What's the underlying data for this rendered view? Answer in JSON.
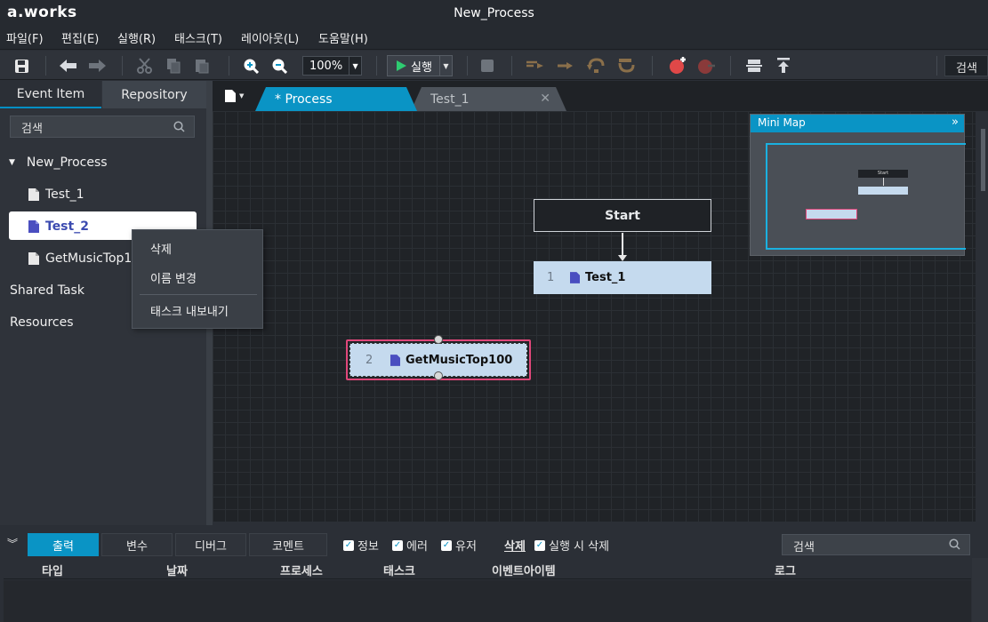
{
  "app": {
    "logo": "a.works",
    "window_title": "New_Process"
  },
  "menu": [
    "파일(F)",
    "편집(E)",
    "실행(R)",
    "태스크(T)",
    "레이아웃(L)",
    "도움말(H)"
  ],
  "toolbar": {
    "zoom": "100%",
    "run_label": "실행",
    "search_label": "검색"
  },
  "left_panel": {
    "tabs": [
      "Event Item",
      "Repository"
    ],
    "active_tab": "Repository",
    "search_placeholder": "검색",
    "tree": {
      "root": "New_Process",
      "children": [
        "Test_1",
        "Test_2",
        "GetMusicTop10"
      ],
      "selected": "Test_2"
    },
    "sections": [
      "Shared Task",
      "Resources"
    ]
  },
  "context_menu": {
    "items": [
      "삭제",
      "이름 변경",
      "태스크 내보내기"
    ]
  },
  "doc_tabs": [
    {
      "label": "* Process",
      "active": true
    },
    {
      "label": "Test_1",
      "active": false
    }
  ],
  "canvas": {
    "start_label": "Start",
    "nodes": [
      {
        "num": "1",
        "name": "Test_1"
      },
      {
        "num": "2",
        "name": "GetMusicTop100"
      }
    ]
  },
  "minimap": {
    "title": "Mini Map",
    "collapse_glyph": "»",
    "start_label": "Start"
  },
  "bottom": {
    "tabs": [
      "출력",
      "변수",
      "디버그",
      "코멘트"
    ],
    "active_tab": "출력",
    "filters": [
      "정보",
      "에러",
      "유저"
    ],
    "delete_label": "삭제",
    "clear_on_run_label": "실행 시 삭제",
    "search_placeholder": "검색",
    "columns": [
      "타입",
      "날짜",
      "프로세스",
      "태스크",
      "이벤트아이템",
      "로그"
    ]
  },
  "colors": {
    "accent": "#0a94c5",
    "selection": "#e0477a",
    "task_fill": "#c5daee"
  }
}
